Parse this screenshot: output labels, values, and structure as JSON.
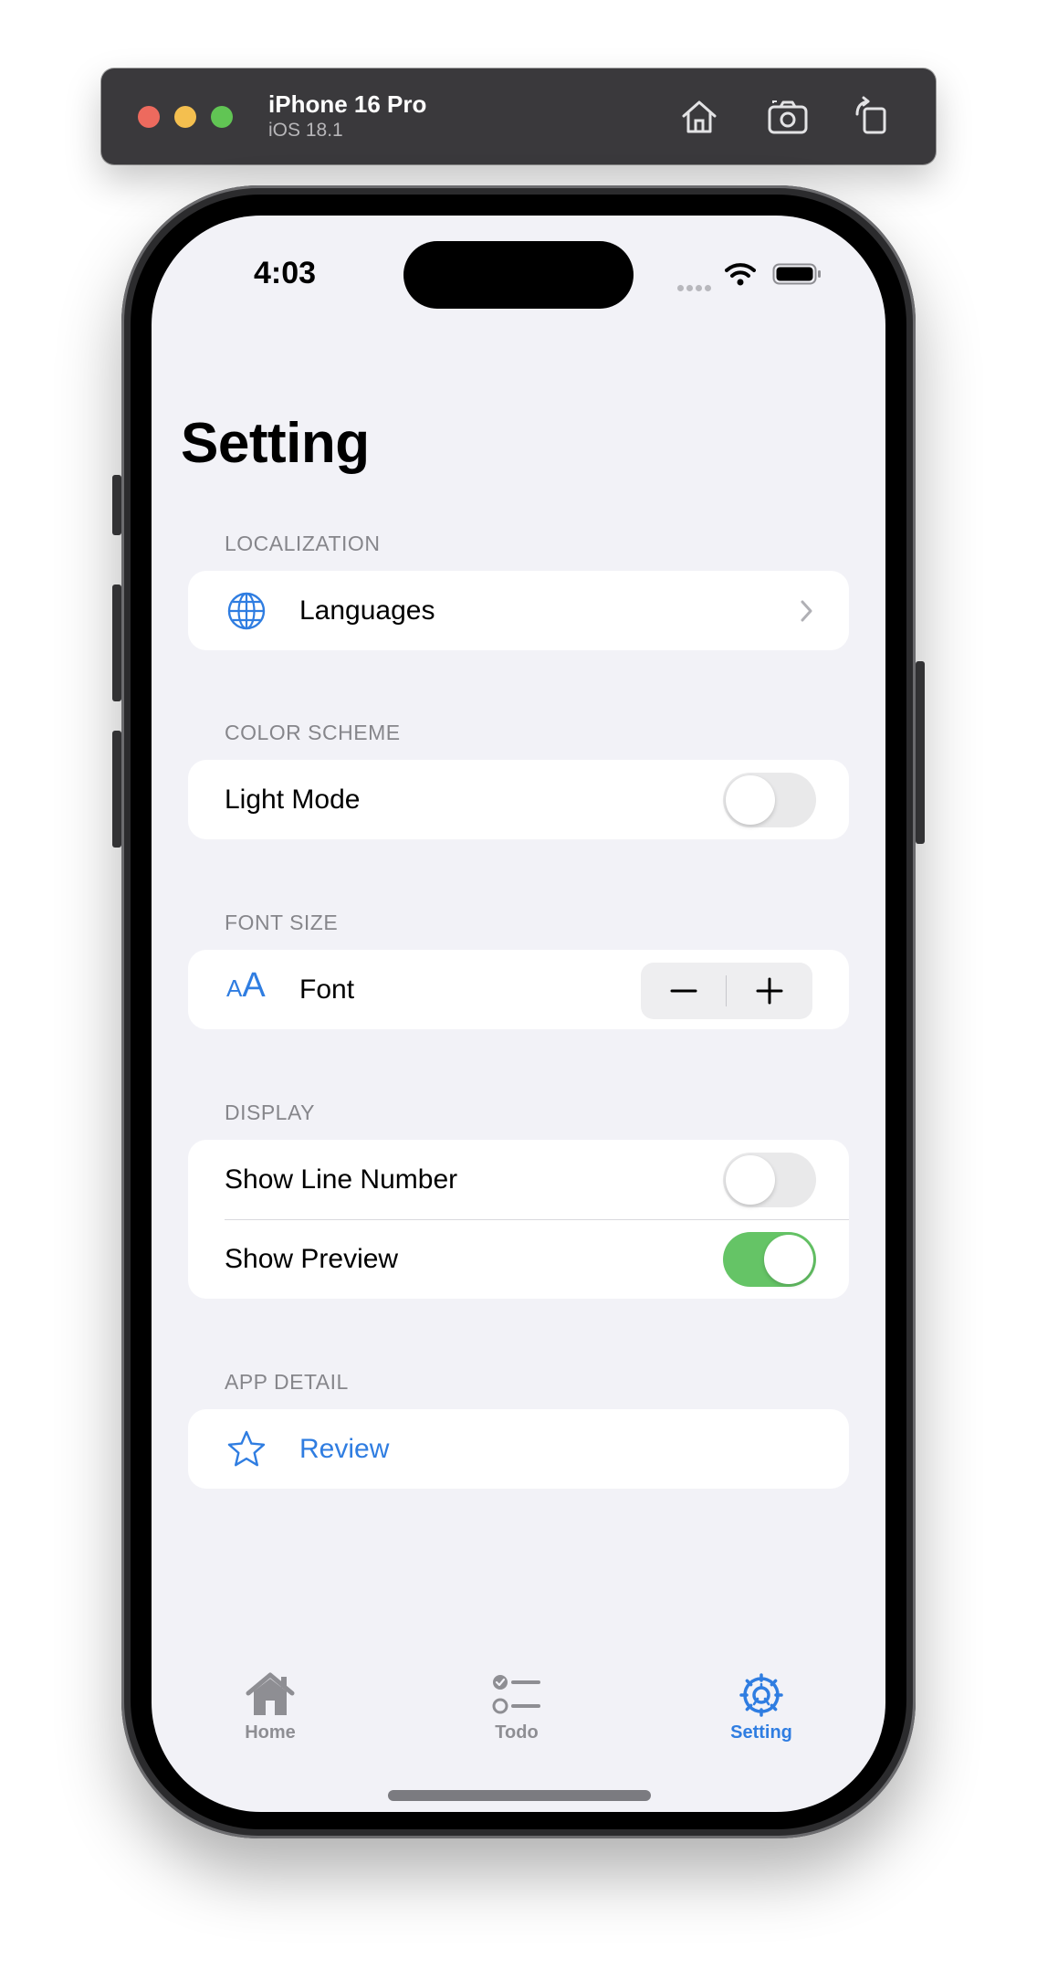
{
  "simulator": {
    "device_name": "iPhone 16 Pro",
    "os_version": "iOS 18.1",
    "toolbar_icons": [
      "home-icon",
      "screenshot-icon",
      "rotate-icon"
    ]
  },
  "status_bar": {
    "time": "4:03"
  },
  "page": {
    "title": "Setting"
  },
  "sections": {
    "localization": {
      "header": "LOCALIZATION",
      "languages_label": "Languages",
      "icon": "globe-icon"
    },
    "color_scheme": {
      "header": "COLOR SCHEME",
      "light_mode_label": "Light Mode",
      "light_mode_on": false
    },
    "font_size": {
      "header": "FONT SIZE",
      "font_label": "Font",
      "icon_small": "A",
      "icon_big": "A"
    },
    "display": {
      "header": "DISPLAY",
      "show_line_number_label": "Show Line Number",
      "show_line_number_on": false,
      "show_preview_label": "Show Preview",
      "show_preview_on": true
    },
    "app_detail": {
      "header": "APP DETAIL",
      "review_label": "Review",
      "icon": "star-icon"
    }
  },
  "tab_bar": {
    "tabs": [
      {
        "label": "Home",
        "icon": "house-icon",
        "active": false
      },
      {
        "label": "Todo",
        "icon": "checklist-icon",
        "active": false
      },
      {
        "label": "Setting",
        "icon": "gear-icon",
        "active": true
      }
    ]
  },
  "colors": {
    "accent": "#2f7de1",
    "toggle_on": "#65c466",
    "background": "#f2f2f7"
  }
}
